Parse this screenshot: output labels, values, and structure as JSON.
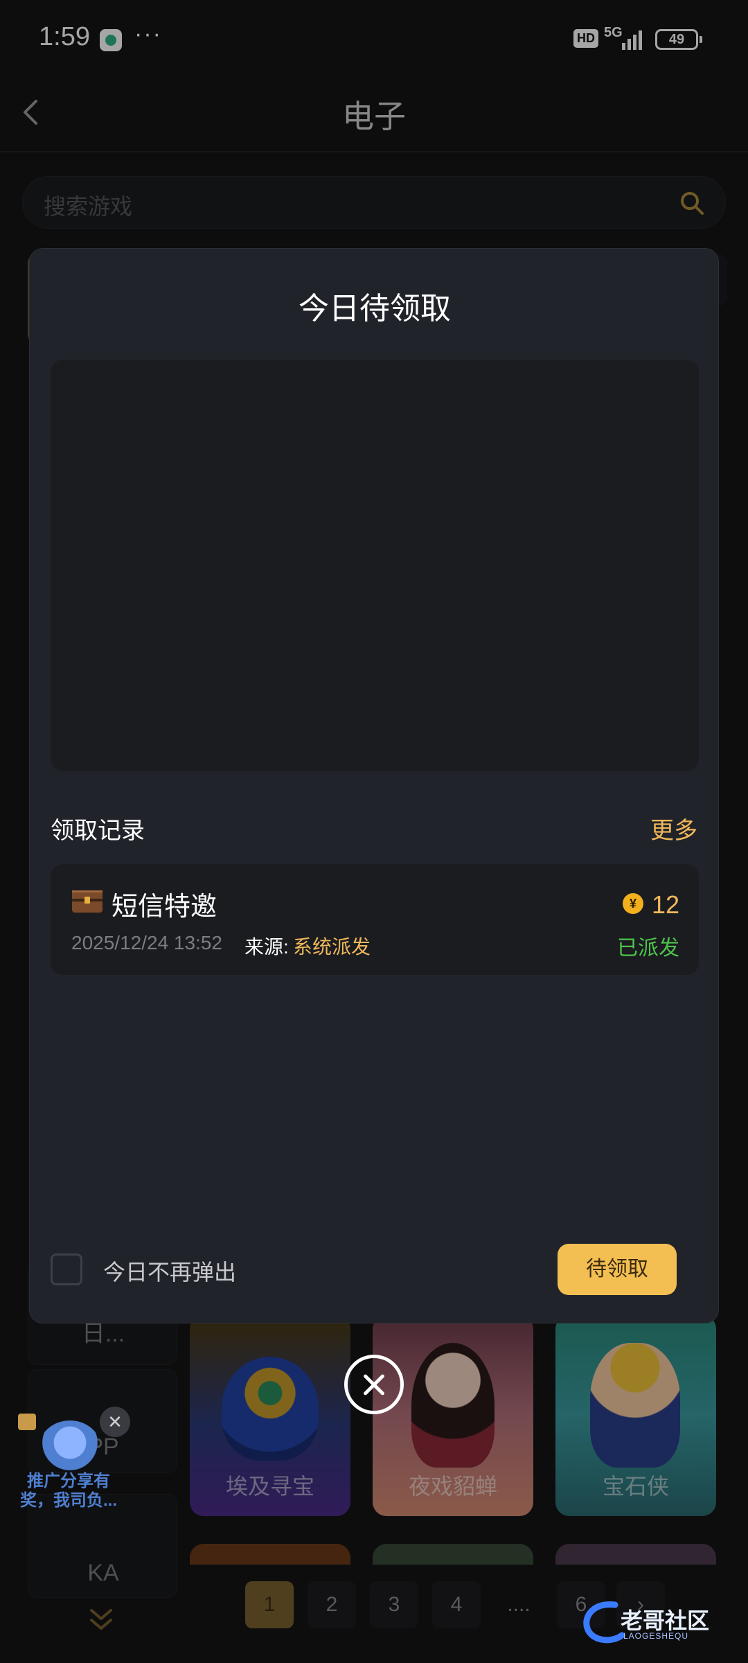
{
  "status_bar": {
    "time": "1:59",
    "dots": "···",
    "hd": "HD",
    "network": "5G",
    "battery": "49"
  },
  "nav": {
    "title": "电子"
  },
  "search": {
    "placeholder": "搜索游戏"
  },
  "background": {
    "categories": [
      "日...",
      "PP",
      "KA"
    ],
    "games": [
      "埃及寻宝",
      "夜戏貂蝉",
      "宝石侠"
    ],
    "pagination": [
      "1",
      "2",
      "3",
      "4",
      "....",
      "6"
    ],
    "active_page": "1"
  },
  "modal": {
    "title": "今日待领取",
    "records_title": "领取记录",
    "more_label": "更多",
    "record": {
      "name": "短信特邀",
      "date": "2025/12/24 13:52",
      "source_label": "来源:",
      "source_value": "系统派发",
      "coin_symbol": "¥",
      "amount": "12",
      "status": "已派发"
    },
    "dont_show_label": "今日不再弹出",
    "claim_button": "待领取"
  },
  "promo": {
    "text_line1": "推广分享有",
    "text_line2": "奖，我司负..."
  },
  "watermark": {
    "text": "老哥社区",
    "sub": "LAOGESHEQU"
  },
  "colors": {
    "accent_gold": "#f3bf52",
    "status_green": "#4cc44a",
    "modal_bg": "#21232a"
  }
}
